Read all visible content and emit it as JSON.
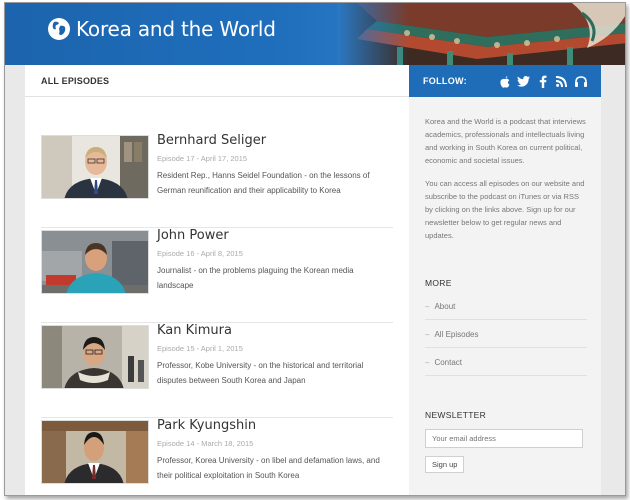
{
  "site": {
    "title": "Korea and the World"
  },
  "main": {
    "heading": "ALL EPISODES"
  },
  "episodes": [
    {
      "title": "Bernhard Seliger",
      "meta": "Episode 17 - April 17, 2015",
      "desc": "Resident Rep., Hanns Seidel Foundation - on the lessons of German reunification and their applicability to Korea"
    },
    {
      "title": "John Power",
      "meta": "Episode 16 - April 8, 2015",
      "desc": "Journalist - on the problems plaguing the Korean media landscape"
    },
    {
      "title": "Kan Kimura",
      "meta": "Episode 15 - April 1, 2015",
      "desc": "Professor, Kobe University - on the historical and territorial disputes between South Korea and Japan"
    },
    {
      "title": "Park Kyungshin",
      "meta": "Episode 14 - March 18, 2015",
      "desc": "Professor, Korea University - on libel and defamation laws, and their political exploitation in South Korea"
    }
  ],
  "sidebar": {
    "follow_label": "FOLLOW:",
    "icons": [
      "apple-icon",
      "twitter-icon",
      "facebook-icon",
      "rss-icon",
      "headphones-icon"
    ],
    "about_p1": "Korea and the World is a podcast that interviews academics, professionals and intellectuals living and working in South Korea on current political, economic and societal issues.",
    "about_p2": "You can access all episodes on our website and subscribe to the podcast on iTunes or via RSS by clicking on the links above. Sign up for our newsletter below to get regular news and updates.",
    "more_heading": "MORE",
    "links": [
      "About",
      "All Episodes",
      "Contact"
    ],
    "newsletter_heading": "NEWSLETTER",
    "email_placeholder": "Your email address",
    "signup_label": "Sign up"
  },
  "colors": {
    "brand_blue": "#1f6db8",
    "header_blue": "#1c64ad"
  }
}
